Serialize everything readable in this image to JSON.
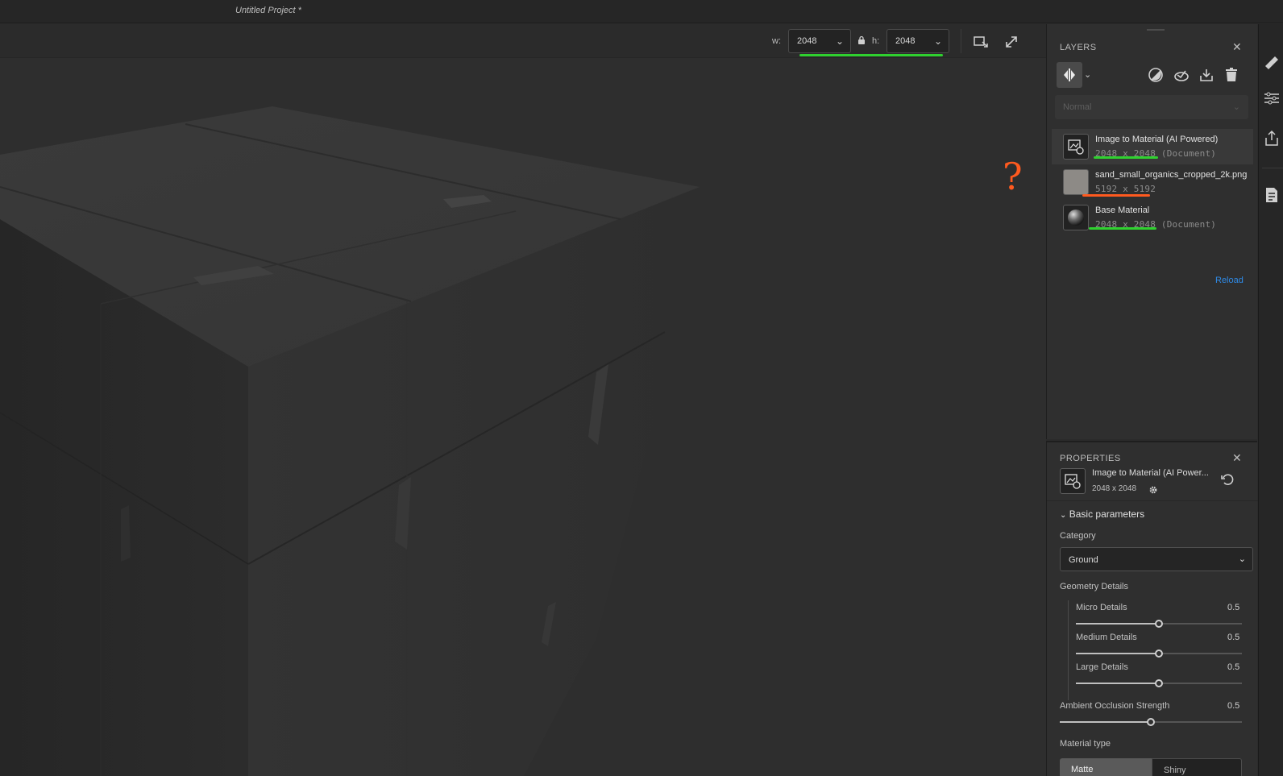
{
  "window": {
    "title": "Untitled Project *"
  },
  "viewport": {
    "width_label": "w:",
    "width_value": "2048",
    "height_label": "h:",
    "height_value": "2048",
    "annotation_mark": "?"
  },
  "layers": {
    "header": "LAYERS",
    "blend_mode": "Normal",
    "items": [
      {
        "name": "Image to Material (AI Powered)",
        "dims": "2048 x 2048",
        "note": "(Document)",
        "selected": true
      },
      {
        "name": "sand_small_organics_cropped_2k.png",
        "dims": "5192 x 5192",
        "note": ""
      },
      {
        "name": "Base Material",
        "dims": "2048 x 2048",
        "note": "(Document)"
      }
    ],
    "reload_label": "Reload"
  },
  "properties": {
    "header": "PROPERTIES",
    "name": "Image to Material (AI Power...",
    "size": "2048 x 2048",
    "section": "Basic parameters",
    "category_label": "Category",
    "category_value": "Ground",
    "geometry_label": "Geometry Details",
    "micro": {
      "label": "Micro Details",
      "value": "0.5",
      "level": 0.5
    },
    "medium": {
      "label": "Medium Details",
      "value": "0.5",
      "level": 0.5
    },
    "large": {
      "label": "Large Details",
      "value": "0.5",
      "level": 0.5
    },
    "ao": {
      "label": "Ambient Occlusion Strength",
      "value": "0.5",
      "level": 0.5
    },
    "material_type_label": "Material type",
    "material_types": [
      "Matte",
      "Shiny"
    ],
    "material_type_selected": "Matte"
  },
  "colors": {
    "annotation_green": "#2fd12f",
    "annotation_orange": "#ff5a1f",
    "link_blue": "#2f8ae6"
  }
}
